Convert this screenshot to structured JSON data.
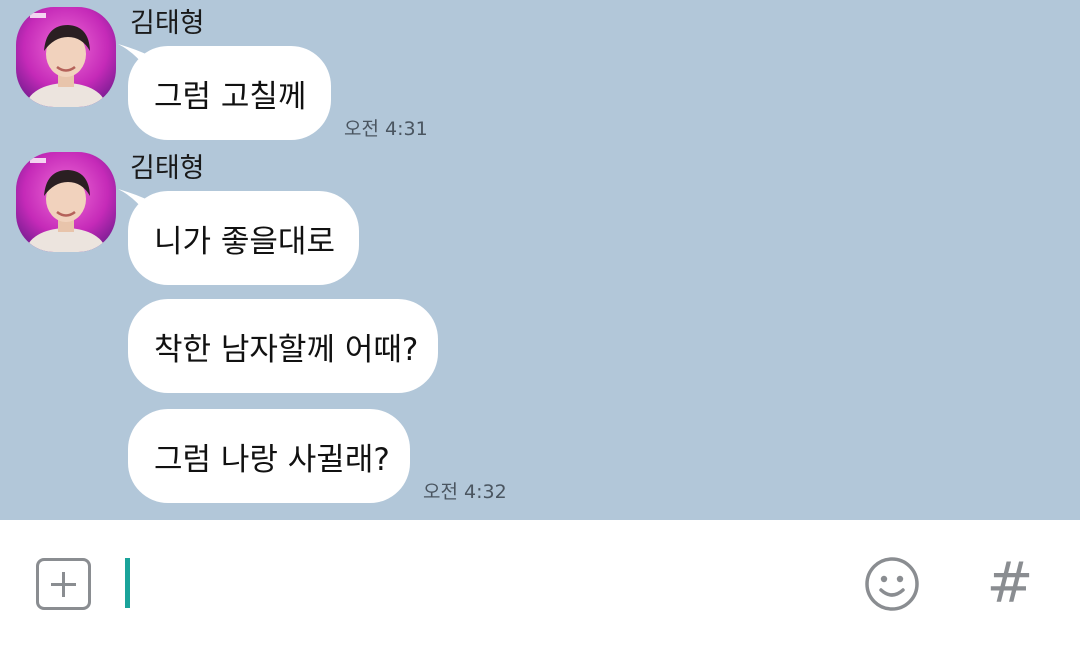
{
  "messages": [
    {
      "sender": "김태형",
      "text": "그럼 고칠께",
      "time": "오전 4:31"
    },
    {
      "sender": "김태형",
      "text": "니가 좋을대로"
    },
    {
      "text": "착한 남자할께 어때?"
    },
    {
      "text": "그럼 나랑 사귈래?",
      "time": "오전 4:32"
    }
  ],
  "input": {
    "value": "",
    "plus_icon": "plus-square-icon",
    "emoji_icon": "smiley-icon",
    "hash_label": "#"
  },
  "colors": {
    "chat_background": "#b2c7d9",
    "bubble": "#ffffff",
    "cursor": "#1aa39a",
    "icon": "#8a8d91"
  }
}
